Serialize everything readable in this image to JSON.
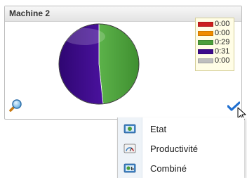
{
  "panel": {
    "title": "Machine 2"
  },
  "legend": {
    "items": [
      {
        "color": "#cc1f1f",
        "value": "0:00"
      },
      {
        "color": "#f08c00",
        "value": "0:00"
      },
      {
        "color": "#4a9e3a",
        "value": "0:29"
      },
      {
        "color": "#3c0a8c",
        "value": "0:31"
      },
      {
        "color": "#bfbfbf",
        "value": "0:00"
      }
    ]
  },
  "chart_data": {
    "type": "pie",
    "slices": [
      {
        "legend_value": "0:29",
        "minutes": 29,
        "color": "#4a9e3a"
      },
      {
        "legend_value": "0:31",
        "minutes": 31,
        "color": "#3c0a8c"
      }
    ]
  },
  "icons": {
    "zoom": "magnifier-icon",
    "check": "checkmark-icon",
    "cursor": "mouse-pointer-icon"
  },
  "menu": {
    "items": [
      {
        "label": "Etat",
        "icon": "state-view-icon"
      },
      {
        "label": "Productivité",
        "icon": "gauge-icon"
      },
      {
        "label": "Combiné",
        "icon": "combined-view-icon"
      }
    ]
  }
}
